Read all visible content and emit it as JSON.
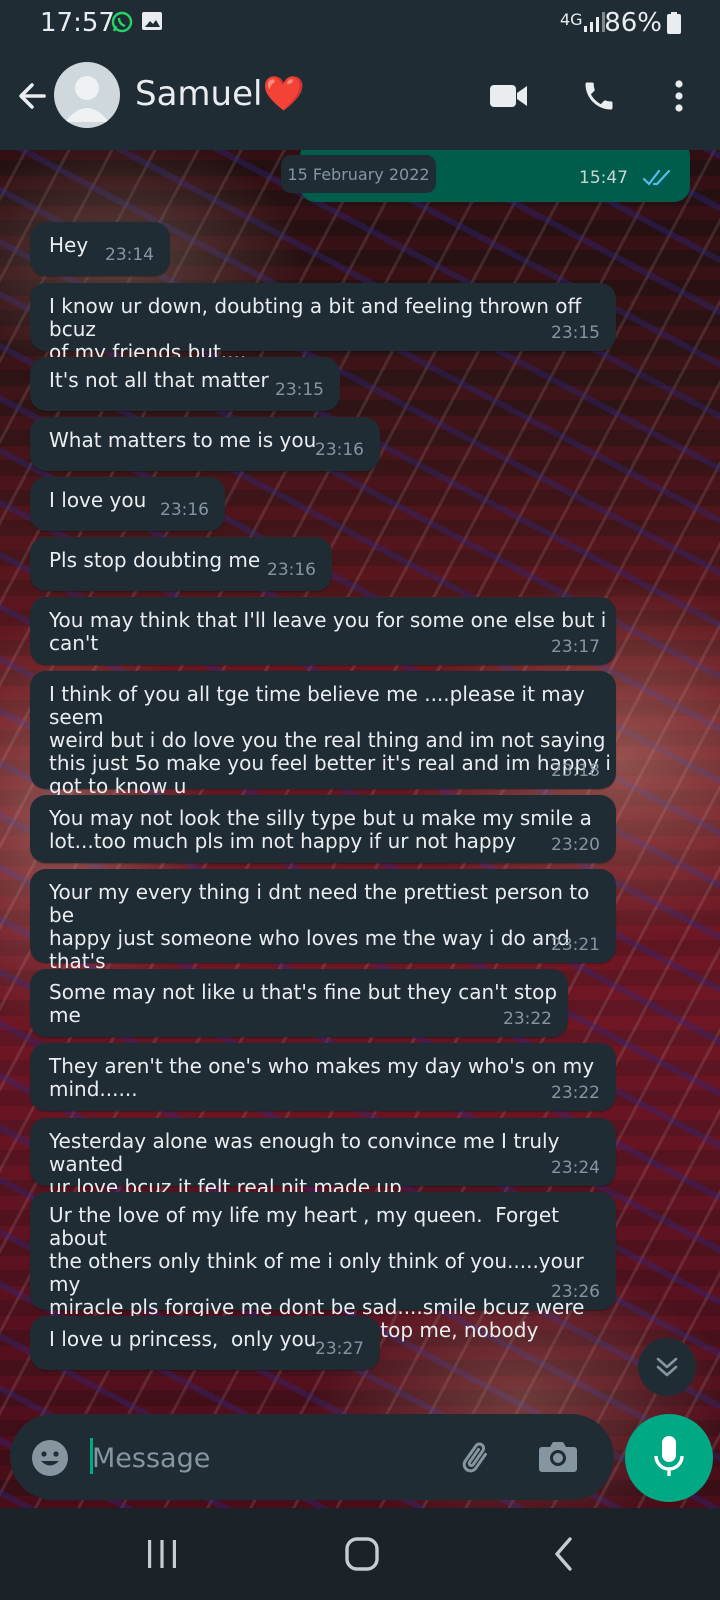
{
  "status_bar": {
    "time": "17:57",
    "network": "4G",
    "battery": "86%"
  },
  "header": {
    "contact_name": "Samuel❤️"
  },
  "chat": {
    "date_chip": "15 February 2022",
    "outgoing_time": "15:47",
    "messages": [
      {
        "text": "Hey",
        "time": "23:14"
      },
      {
        "text": "I know ur down, doubting a bit and feeling thrown off bcuz\nof my friends but....",
        "time": "23:15"
      },
      {
        "text": "It's not all that matter",
        "time": "23:15"
      },
      {
        "text": "What matters to me is you",
        "time": "23:16"
      },
      {
        "text": "I love you",
        "time": "23:16"
      },
      {
        "text": "Pls stop doubting me",
        "time": "23:16"
      },
      {
        "text": "You may think that I'll leave you for some one else but i\ncan't",
        "time": "23:17"
      },
      {
        "text": "I think of you all tge time believe me ....please it may seem\nweird but i do love you the real thing and im not saying\nthis just 5o make you feel better it's real and im happy i\ngot to know u",
        "time": "23:18"
      },
      {
        "text": "You may not look the silly type but u make my smile a\nlot...too much pls im not happy if ur not happy",
        "time": "23:20"
      },
      {
        "text": "Your my every thing i dnt need the prettiest person to be\nhappy just someone who loves me the way i do and that's\nu",
        "time": "23:21"
      },
      {
        "text": "Some may not like u that's fine but they can't stop me",
        "time": "23:22"
      },
      {
        "text": "They aren't the one's who makes my day who's on my\nmind......",
        "time": "23:22"
      },
      {
        "text": "Yesterday alone was enough to convince me I truly wanted\nur love bcuz it felt real nit made up",
        "time": "23:24"
      },
      {
        "text": "Ur the love of my life my heart , my queen.  Forget about\nthe others only think of me i only think of you.....your my\nmiracle pls forgive me dont be sad....smile bcuz were\ngonna last and nobody's gonna stop me, nobody",
        "time": "23:26"
      },
      {
        "text": "I love u princess,  only you",
        "time": "23:27"
      }
    ]
  },
  "input": {
    "placeholder": "Message"
  },
  "colors": {
    "header_bg": "#1f2c34",
    "bubble_in": "#1f2c34",
    "bubble_out": "#005c4b",
    "accent": "#00a884",
    "read_tick": "#53bdeb",
    "meta_text": "#8696a0"
  },
  "icons": [
    "whatsapp-icon",
    "gallery-icon",
    "signal-icon",
    "battery-icon",
    "back-arrow-icon",
    "video-call-icon",
    "voice-call-icon",
    "more-options-icon",
    "double-check-icon",
    "scroll-down-icon",
    "emoji-icon",
    "attach-icon",
    "camera-icon",
    "mic-icon",
    "recent-apps-icon",
    "home-icon",
    "nav-back-icon"
  ]
}
